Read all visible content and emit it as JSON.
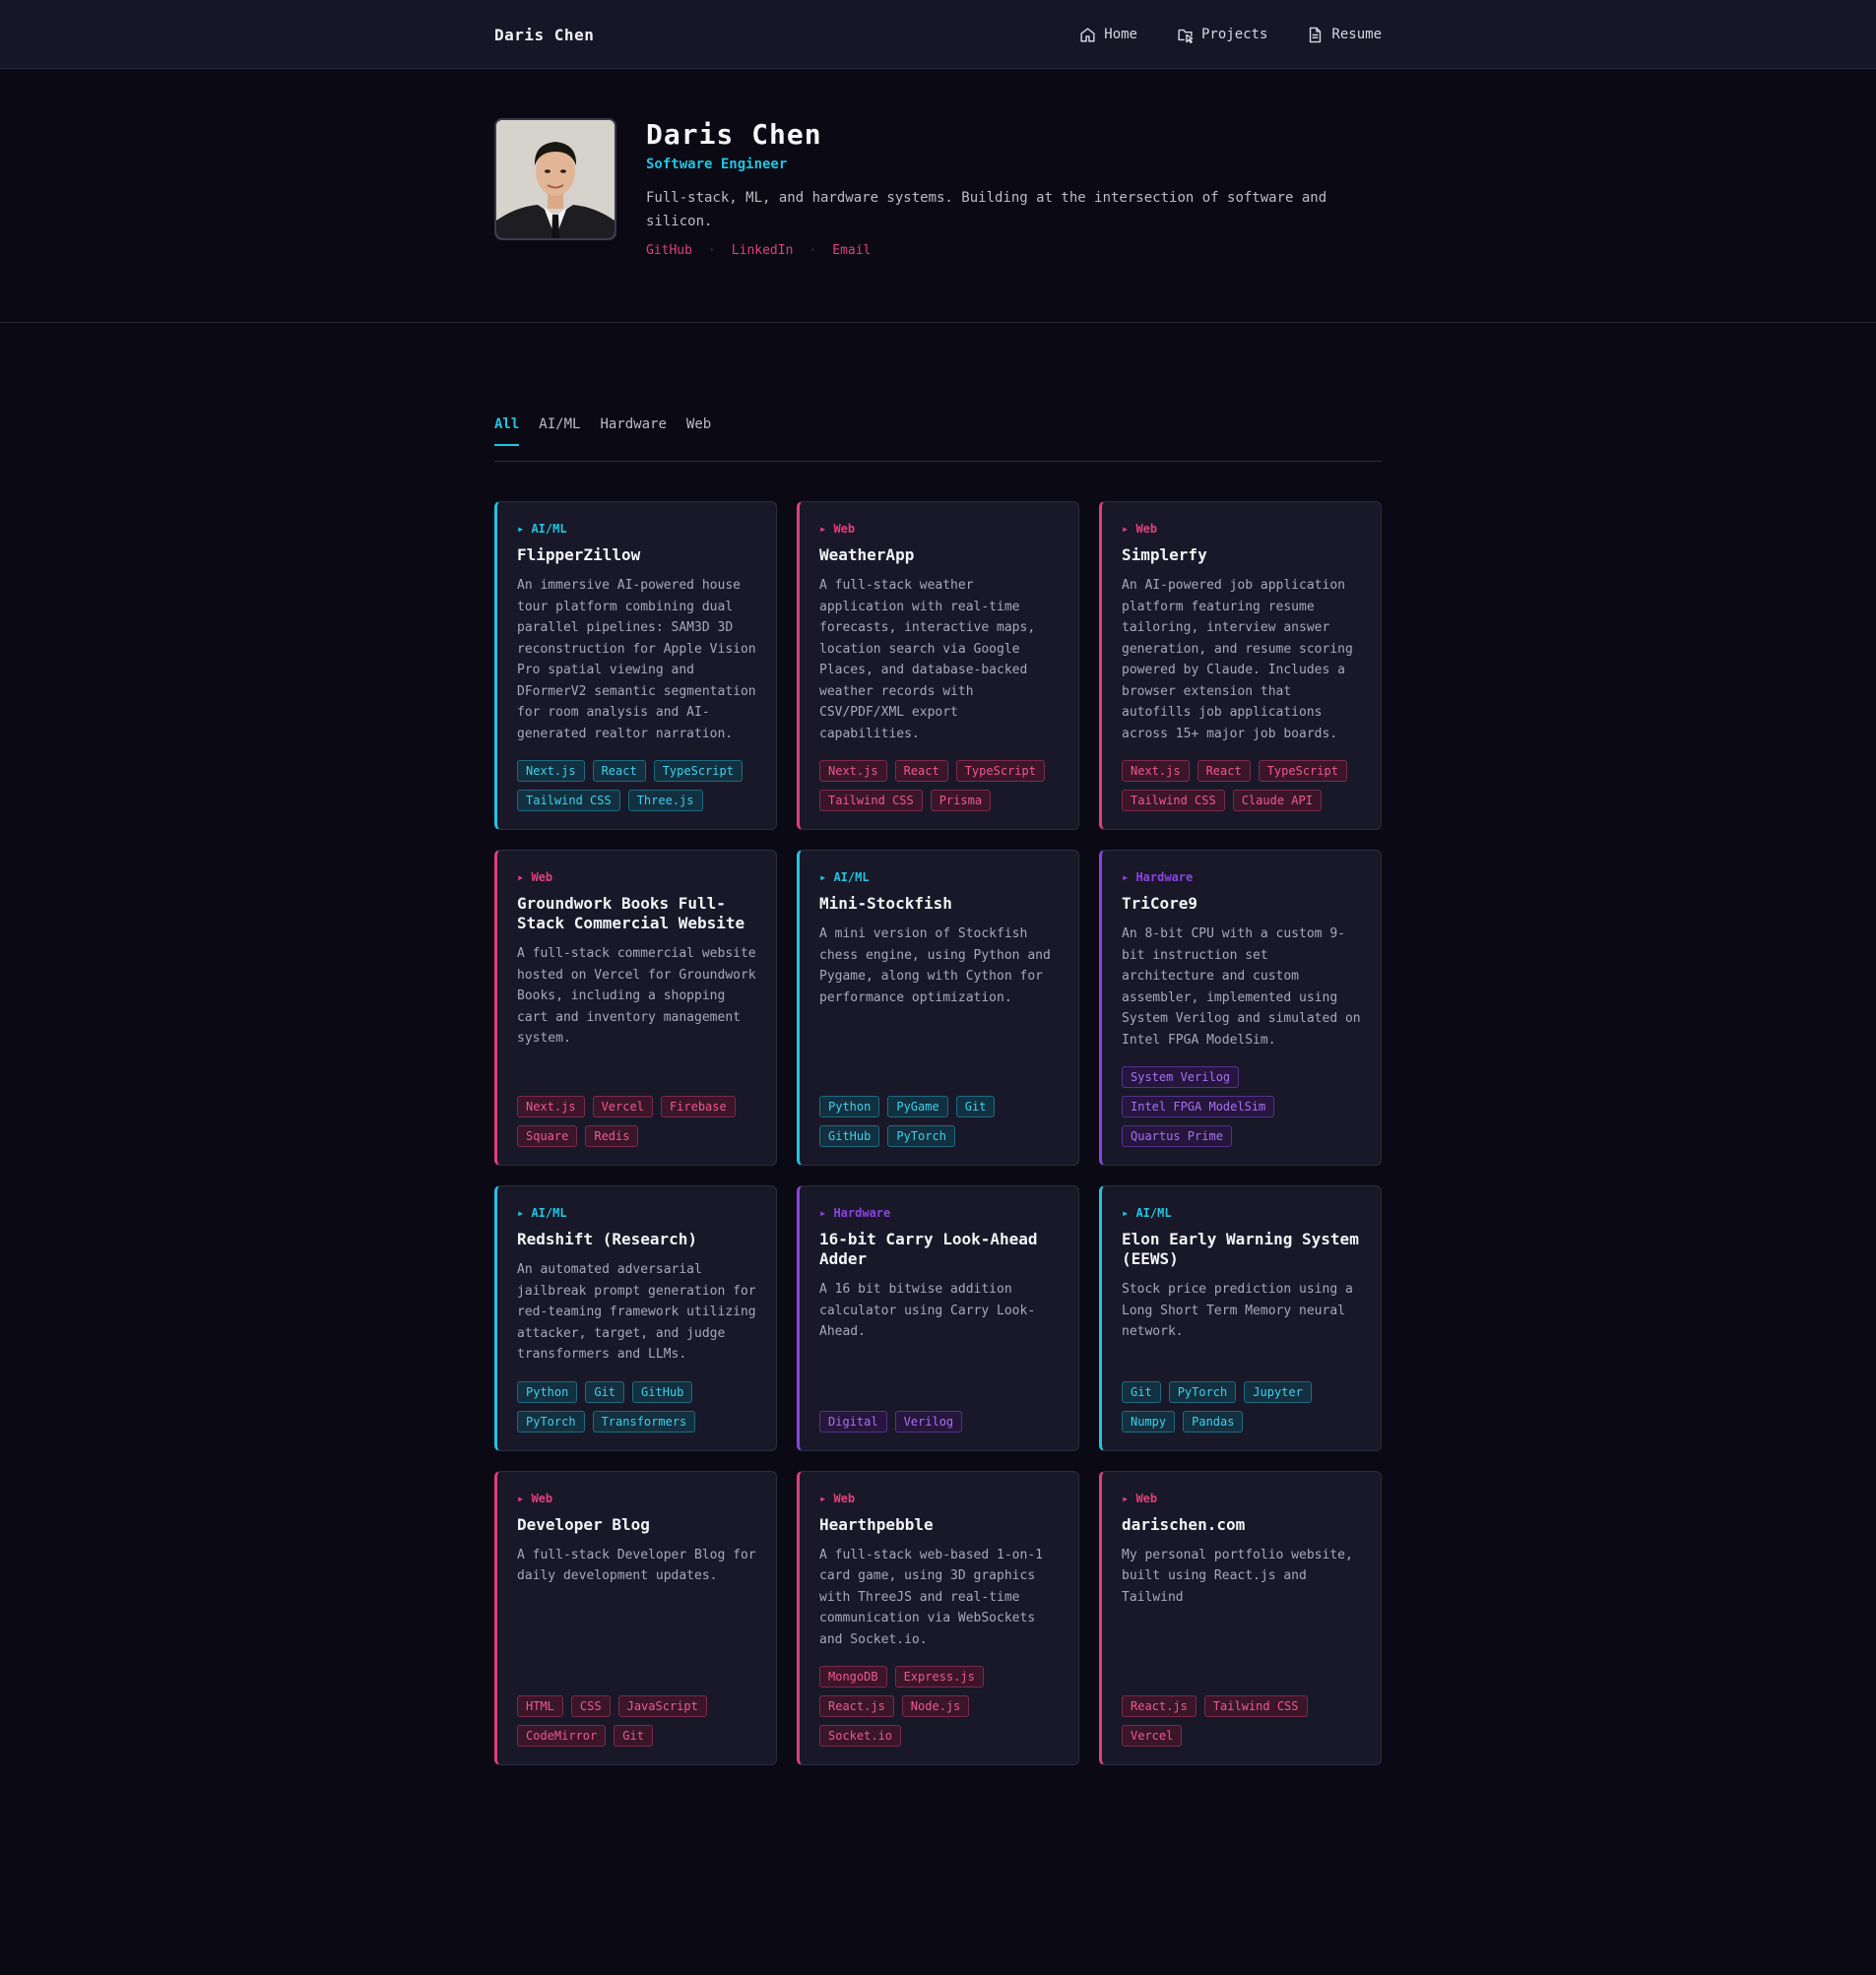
{
  "nav": {
    "brand": "Daris Chen",
    "links": [
      {
        "label": "Home",
        "icon": "home-icon"
      },
      {
        "label": "Projects",
        "icon": "projects-icon"
      },
      {
        "label": "Resume",
        "icon": "document-icon"
      }
    ]
  },
  "hero": {
    "name": "Daris Chen",
    "role": "Software Engineer",
    "bio": "Full-stack, ML, and hardware systems. Building at the intersection of software and silicon.",
    "links": [
      "GitHub",
      "LinkedIn",
      "Email"
    ],
    "separator": "·"
  },
  "filters": [
    "All",
    "AI/ML",
    "Hardware",
    "Web"
  ],
  "colors": {
    "cyan": "#22c4e0",
    "pink": "#e0407a",
    "purple": "#8a44e0",
    "background": "#0b0a14",
    "card": "#181828"
  },
  "projects": [
    {
      "category": "AI/ML",
      "title": "FlipperZillow",
      "description": "An immersive AI-powered house tour platform combining dual parallel pipelines: SAM3D 3D reconstruction for Apple Vision Pro spatial viewing and DFormerV2 semantic segmentation for room analysis and AI-generated realtor narration.",
      "tags": [
        "Next.js",
        "React",
        "TypeScript",
        "Tailwind CSS",
        "Three.js"
      ]
    },
    {
      "category": "Web",
      "title": "WeatherApp",
      "description": "A full-stack weather application with real-time forecasts, interactive maps, location search via Google Places, and database-backed weather records with CSV/PDF/XML export capabilities.",
      "tags": [
        "Next.js",
        "React",
        "TypeScript",
        "Tailwind CSS",
        "Prisma"
      ]
    },
    {
      "category": "Web",
      "title": "Simplerfy",
      "description": "An AI-powered job application platform featuring resume tailoring, interview answer generation, and resume scoring powered by Claude. Includes a browser extension that autofills job applications across 15+ major job boards.",
      "tags": [
        "Next.js",
        "React",
        "TypeScript",
        "Tailwind CSS",
        "Claude API"
      ]
    },
    {
      "category": "Web",
      "title": "Groundwork Books Full-Stack Commercial Website",
      "description": "A full-stack commercial website hosted on Vercel for Groundwork Books, including a shopping cart and inventory management system.",
      "tags": [
        "Next.js",
        "Vercel",
        "Firebase",
        "Square",
        "Redis"
      ]
    },
    {
      "category": "AI/ML",
      "title": "Mini-Stockfish",
      "description": "A mini version of Stockfish chess engine, using Python and Pygame, along with Cython for performance optimization.",
      "tags": [
        "Python",
        "PyGame",
        "Git",
        "GitHub",
        "PyTorch"
      ]
    },
    {
      "category": "Hardware",
      "title": "TriCore9",
      "description": "An 8-bit CPU with a custom 9-bit instruction set architecture and custom assembler, implemented using System Verilog and simulated on Intel FPGA ModelSim.",
      "tags": [
        "System Verilog",
        "Intel FPGA ModelSim",
        "Quartus Prime"
      ]
    },
    {
      "category": "AI/ML",
      "title": "Redshift (Research)",
      "description": "An automated adversarial jailbreak prompt generation for red-teaming framework utilizing attacker, target, and judge transformers and LLMs.",
      "tags": [
        "Python",
        "Git",
        "GitHub",
        "PyTorch",
        "Transformers"
      ]
    },
    {
      "category": "Hardware",
      "title": "16-bit Carry Look-Ahead Adder",
      "description": "A 16 bit bitwise addition calculator using Carry Look-Ahead.",
      "tags": [
        "Digital",
        "Verilog"
      ]
    },
    {
      "category": "AI/ML",
      "title": "Elon Early Warning System (EEWS)",
      "description": "Stock price prediction using a Long Short Term Memory neural network.",
      "tags": [
        "Git",
        "PyTorch",
        "Jupyter",
        "Numpy",
        "Pandas"
      ]
    },
    {
      "category": "Web",
      "title": "Developer Blog",
      "description": "A full-stack Developer Blog for daily development updates.",
      "tags": [
        "HTML",
        "CSS",
        "JavaScript",
        "CodeMirror",
        "Git"
      ]
    },
    {
      "category": "Web",
      "title": "Hearthpebble",
      "description": "A full-stack web-based 1-on-1 card game, using 3D graphics with ThreeJS and real-time communication via WebSockets and Socket.io.",
      "tags": [
        "MongoDB",
        "Express.js",
        "React.js",
        "Node.js",
        "Socket.io"
      ]
    },
    {
      "category": "Web",
      "title": "darischen.com",
      "description": "My personal portfolio website, built using React.js and Tailwind",
      "tags": [
        "React.js",
        "Tailwind CSS",
        "Vercel"
      ]
    }
  ]
}
